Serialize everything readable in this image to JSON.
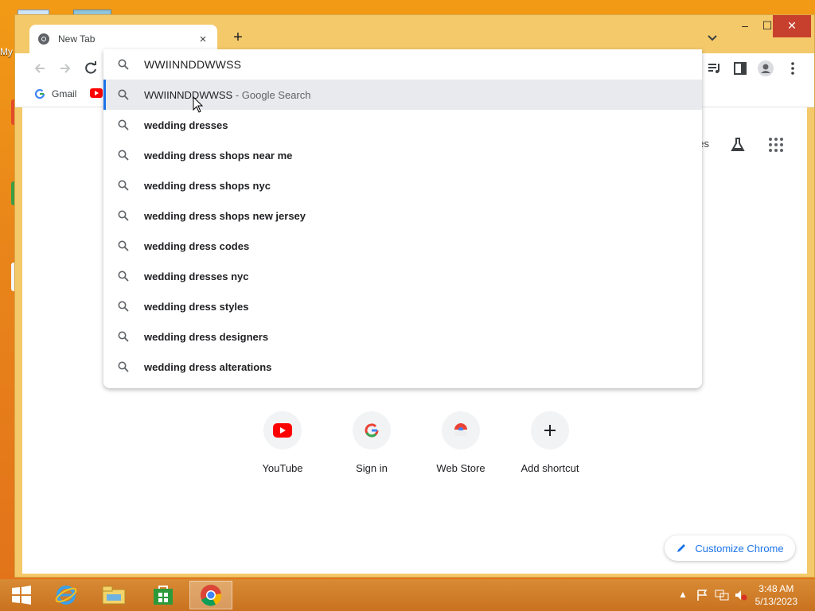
{
  "desktop": {
    "icon_label": "My"
  },
  "browser": {
    "tab_title": "New Tab",
    "tab_close": "×",
    "new_tab": "+",
    "window_controls": {
      "minimize": "–",
      "maximize": "☐",
      "close": "✕"
    },
    "bookmarks": [
      {
        "label": "Gmail",
        "icon": "google-g-icon"
      },
      {
        "label": "",
        "icon": "youtube-icon"
      }
    ],
    "top_right_partial": "ges",
    "customize_label": "Customize Chrome",
    "shortcuts": [
      {
        "label": "YouTube",
        "icon": "youtube-icon"
      },
      {
        "label": "Sign in",
        "icon": "google-g-icon"
      },
      {
        "label": "Web Store",
        "icon": "webstore-icon"
      },
      {
        "label": "Add shortcut",
        "icon": "plus-icon"
      }
    ]
  },
  "omnibox": {
    "input_value": "WWIINNDDWWSS",
    "suggestions": [
      {
        "main": "WWIINNDDWWSS",
        "suffix": "Google Search",
        "separator": " - ",
        "bold": false,
        "selected": true
      },
      {
        "main": "wedding dresses",
        "bold": true
      },
      {
        "main": "wedding dress shops near me",
        "bold": true
      },
      {
        "main": "wedding dress shops nyc",
        "bold": true
      },
      {
        "main": "wedding dress shops new jersey",
        "bold": true
      },
      {
        "main": "wedding dress codes",
        "bold": true
      },
      {
        "main": "wedding dresses nyc",
        "bold": true
      },
      {
        "main": "wedding dress styles",
        "bold": true
      },
      {
        "main": "wedding dress designers",
        "bold": true
      },
      {
        "main": "wedding dress alterations",
        "bold": true
      }
    ]
  },
  "taskbar": {
    "time": "3:48 AM",
    "date": "5/13/2023"
  },
  "colors": {
    "accent": "#1a73e8",
    "window_frame": "#f4c96a",
    "close_button": "#c7402d",
    "taskbar": "#c97220"
  }
}
